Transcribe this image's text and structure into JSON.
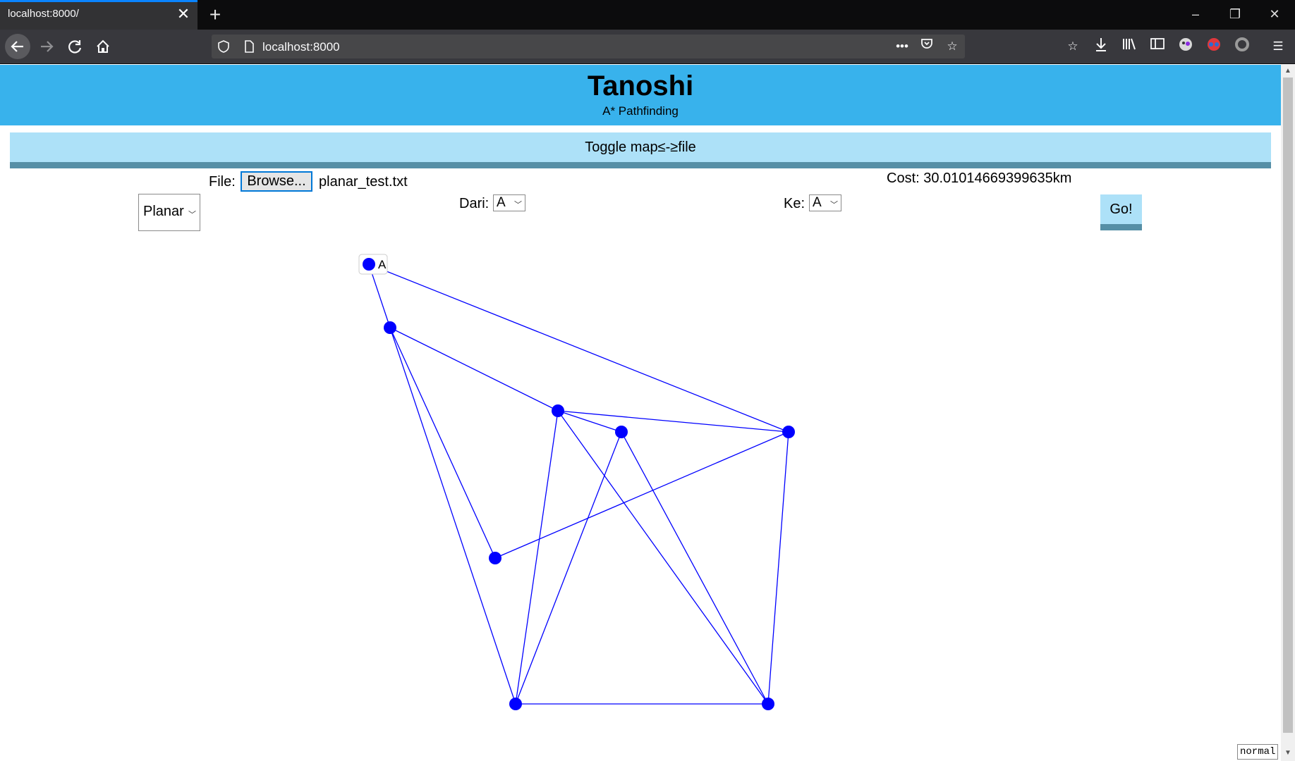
{
  "browser": {
    "tab_title": "localhost:8000/",
    "url": "localhost:8000",
    "new_tab_symbol": "+",
    "close_symbol": "✕",
    "window_controls": {
      "minimize": "–",
      "restore": "❐",
      "close": "✕"
    }
  },
  "header": {
    "title": "Tanoshi",
    "subtitle": "A* Pathfinding"
  },
  "toggle": {
    "label": "Toggle map≤-≥file"
  },
  "controls": {
    "file_label": "File:",
    "browse_label": "Browse...",
    "file_name": "planar_test.txt",
    "mode_value": "Planar",
    "from_label": "Dari:",
    "from_value": "A",
    "to_label": "Ke:",
    "to_value": "A",
    "cost_text": "Cost: 30.01014669399635km",
    "go_label": "Go!"
  },
  "graph": {
    "node_color": "#0000ff",
    "edge_color": "#0000ff",
    "nodes": [
      {
        "id": "A",
        "label": "A"
      },
      {
        "id": "n2",
        "label": ""
      },
      {
        "id": "n3",
        "label": ""
      },
      {
        "id": "n4",
        "label": ""
      },
      {
        "id": "n5",
        "label": ""
      },
      {
        "id": "n6",
        "label": ""
      },
      {
        "id": "n7",
        "label": ""
      },
      {
        "id": "n8",
        "label": ""
      }
    ],
    "edges": [
      [
        "A",
        "n2"
      ],
      [
        "A",
        "n5"
      ],
      [
        "n2",
        "n3"
      ],
      [
        "n2",
        "n6"
      ],
      [
        "n2",
        "n7"
      ],
      [
        "n3",
        "n4"
      ],
      [
        "n3",
        "n5"
      ],
      [
        "n3",
        "n7"
      ],
      [
        "n3",
        "n8"
      ],
      [
        "n4",
        "n7"
      ],
      [
        "n4",
        "n8"
      ],
      [
        "n5",
        "n6"
      ],
      [
        "n5",
        "n8"
      ],
      [
        "n7",
        "n8"
      ]
    ]
  },
  "status_badge": "normal"
}
